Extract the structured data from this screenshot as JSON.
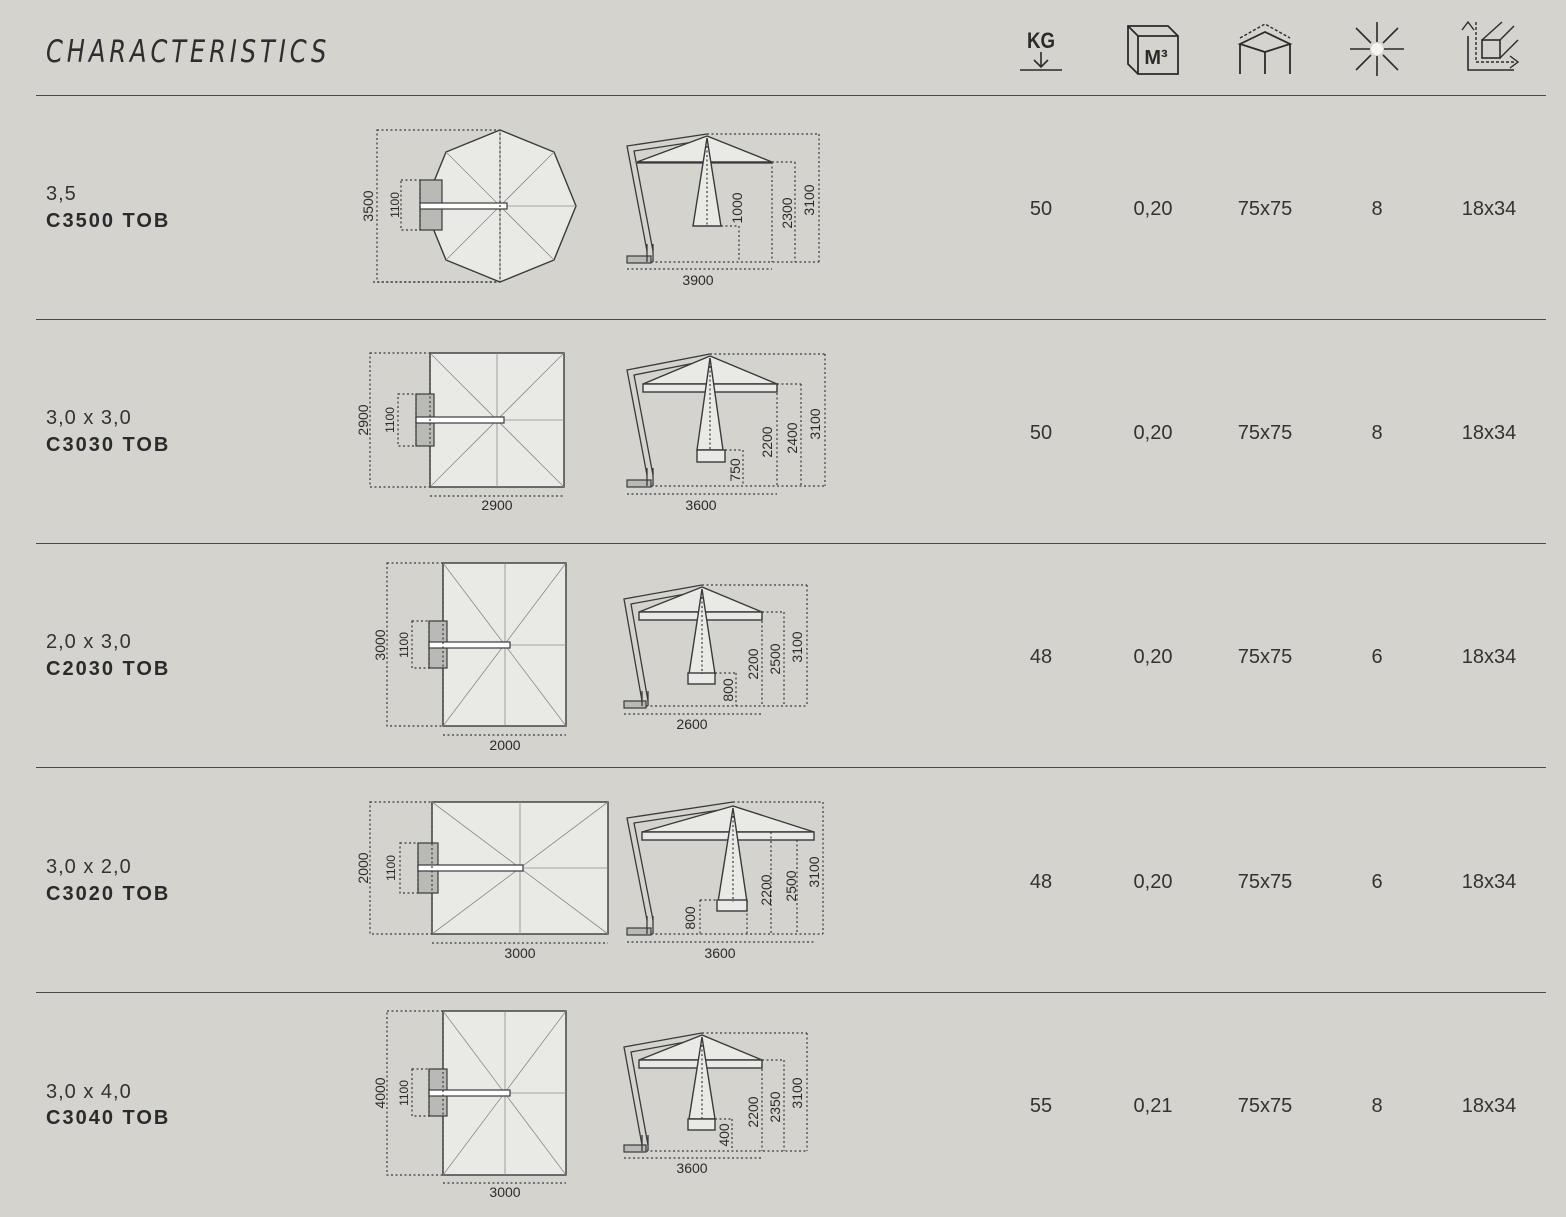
{
  "header": {
    "title": "CHARACTERISTICS",
    "icons": [
      {
        "name": "weight-kg-icon",
        "label": "KG"
      },
      {
        "name": "volume-m3-icon",
        "label": "M³"
      },
      {
        "name": "package-icon",
        "label": ""
      },
      {
        "name": "ribs-icon",
        "label": ""
      },
      {
        "name": "dimensions-icon",
        "label": ""
      }
    ]
  },
  "rows": [
    {
      "size": "3,5",
      "code": "C3500 TOB",
      "weight": "50",
      "volume": "0,20",
      "base": "75x75",
      "ribs": "8",
      "pole": "18x34",
      "plan_dims": {
        "outer": "3500",
        "inner": "1100",
        "width": ""
      },
      "side_dims": {
        "h1": "1000",
        "h2": "2300",
        "h3": "3100",
        "length": "3900"
      }
    },
    {
      "size": "3,0 x 3,0",
      "code": "C3030 TOB",
      "weight": "50",
      "volume": "0,20",
      "base": "75x75",
      "ribs": "8",
      "pole": "18x34",
      "plan_dims": {
        "outer": "2900",
        "inner": "1100",
        "width": "2900"
      },
      "side_dims": {
        "h1": "750",
        "h2": "2200",
        "h3": "2400",
        "h4": "3100",
        "length": "3600"
      }
    },
    {
      "size": "2,0 x 3,0",
      "code": "C2030 TOB",
      "weight": "48",
      "volume": "0,20",
      "base": "75x75",
      "ribs": "6",
      "pole": "18x34",
      "plan_dims": {
        "outer": "3000",
        "inner": "1100",
        "width": "2000"
      },
      "side_dims": {
        "h1": "800",
        "h2": "2200",
        "h3": "2500",
        "h4": "3100",
        "length": "2600"
      }
    },
    {
      "size": "3,0 x 2,0",
      "code": "C3020 TOB",
      "weight": "48",
      "volume": "0,20",
      "base": "75x75",
      "ribs": "6",
      "pole": "18x34",
      "plan_dims": {
        "outer": "2000",
        "inner": "1100",
        "width": "3000"
      },
      "side_dims": {
        "h1": "800",
        "h2": "2200",
        "h3": "2500",
        "h4": "3100",
        "length": "3600"
      }
    },
    {
      "size": "3,0 x 4,0",
      "code": "C3040 TOB",
      "weight": "55",
      "volume": "0,21",
      "base": "75x75",
      "ribs": "8",
      "pole": "18x34",
      "plan_dims": {
        "outer": "4000",
        "inner": "1100",
        "width": "3000"
      },
      "side_dims": {
        "h1": "400",
        "h2": "2200",
        "h3": "2350",
        "h4": "3100",
        "length": "3600"
      }
    }
  ]
}
